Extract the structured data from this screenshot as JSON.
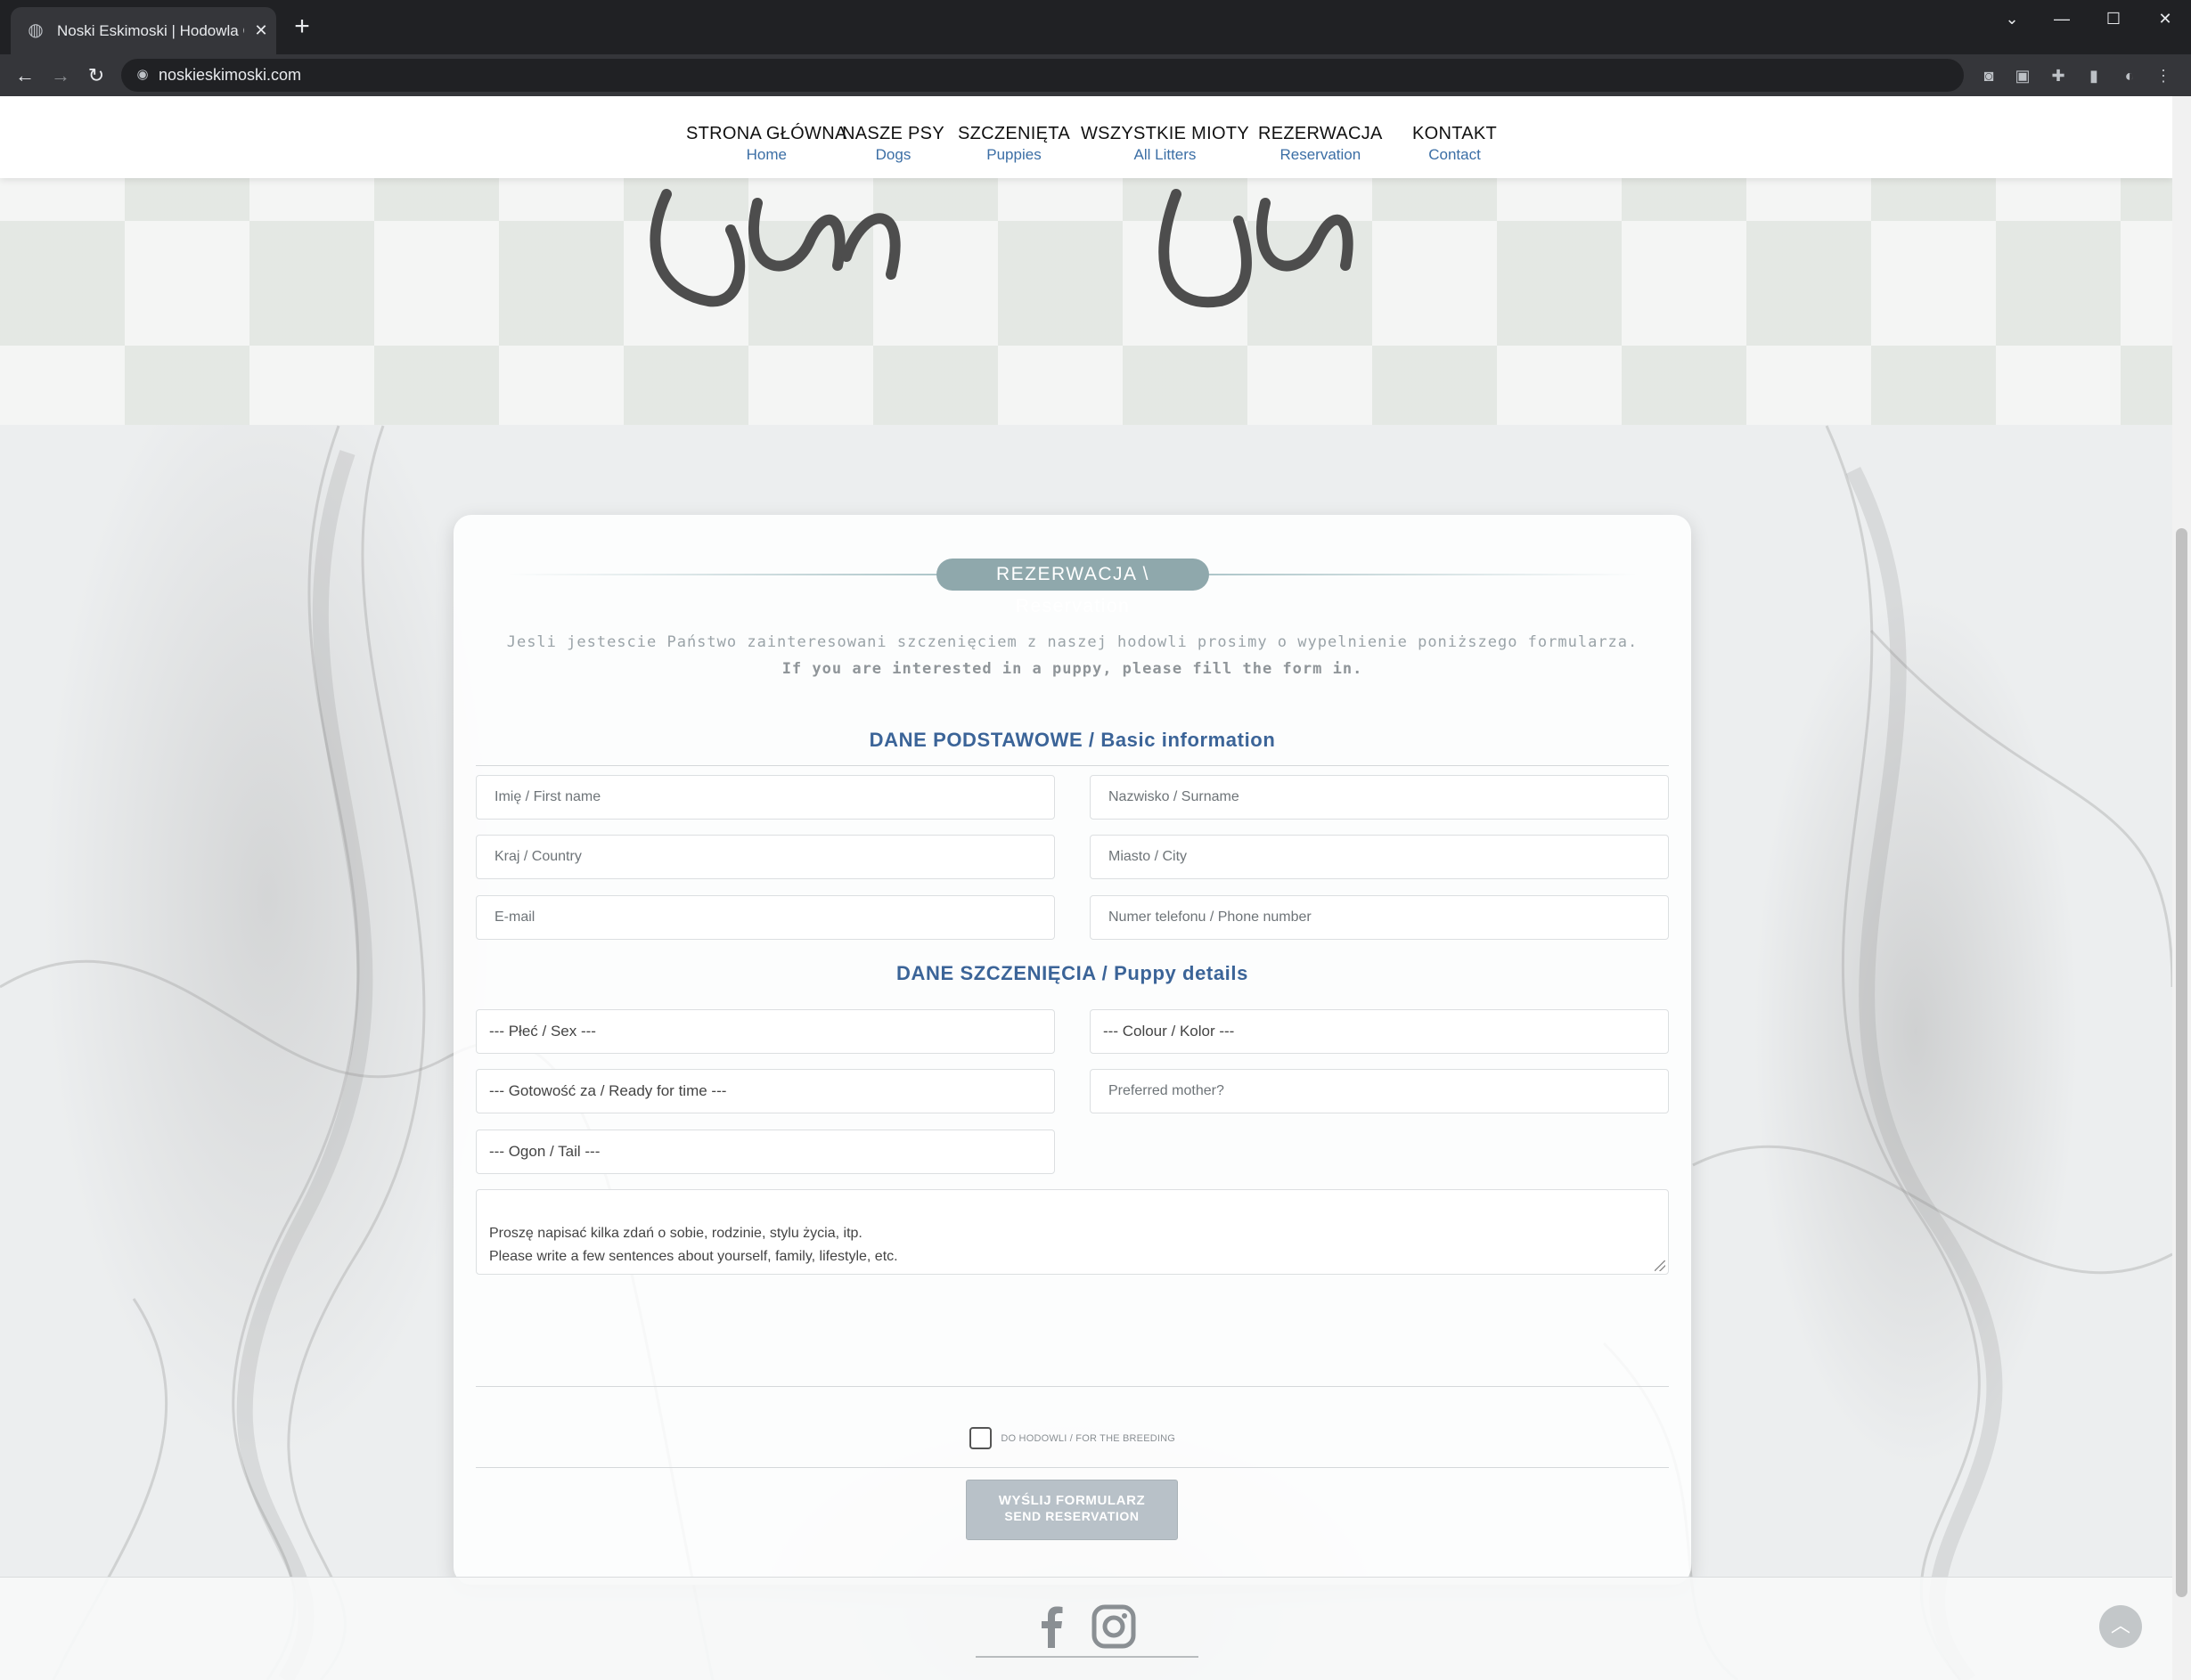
{
  "browser": {
    "tab_title": "Noski Eskimoski | Hodowla Charc",
    "url": "noskieskimoski.com"
  },
  "nav": {
    "items": [
      {
        "main": "STRONA GŁÓWNA",
        "sub": "Home"
      },
      {
        "main": "NASZE PSY",
        "sub": "Dogs"
      },
      {
        "main": "SZCZENIĘTA",
        "sub": "Puppies"
      },
      {
        "main": "WSZYSTKIE MIOTY",
        "sub": "All Litters"
      },
      {
        "main": "REZERWACJA",
        "sub": "Reservation"
      },
      {
        "main": "KONTAKT",
        "sub": "Contact"
      }
    ]
  },
  "form": {
    "heading": "REZERWACJA \\ Reservation",
    "intro_pl": "Jesli jestescie Państwo zainteresowani szczenięciem z naszej hodowli prosimy o wypelnienie poniższego formularza.",
    "intro_en": "If you are interested in a puppy, please fill the form in.",
    "basic_title": "DANE PODSTAWOWE / Basic information",
    "first_name_placeholder": "Imię / First name",
    "surname_placeholder": "Nazwisko / Surname",
    "country_placeholder": "Kraj / Country",
    "city_placeholder": "Miasto / City",
    "email_placeholder": "E-mail",
    "phone_placeholder": "Numer telefonu / Phone number",
    "puppy_title": "DANE SZCZENIĘCIA / Puppy details",
    "sex_select": "--- Płeć / Sex ---",
    "colour_select": "--- Colour / Kolor ---",
    "ready_select": "--- Gotowość za / Ready for time ---",
    "mother_placeholder": "Preferred mother?",
    "tail_select": "--- Ogon / Tail ---",
    "about_placeholder": "Proszę napisać kilka zdań o sobie, rodzinie, stylu życia, itp.\nPlease write a few sentences about yourself, family, lifestyle, etc.",
    "breeding_checkbox_label": "DO HODOWLI / FOR THE BREEDING",
    "breeding_checked": false,
    "submit_line1": "WYŚLIJ FORMULARZ",
    "submit_line2": "SEND RESERVATION"
  },
  "footer": {
    "social": [
      "facebook-icon",
      "instagram-icon"
    ]
  },
  "colors": {
    "accent_blue": "#3b6498",
    "heading_pill": "#8fa8ac",
    "submit_bg": "#b8c1c8"
  }
}
